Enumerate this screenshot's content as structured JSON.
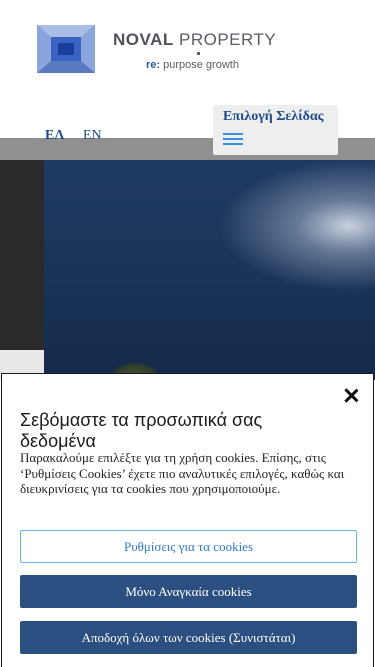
{
  "header": {
    "brand_name": "NOVAL",
    "brand_suffix": "PROPERTY",
    "tagline_prefix": "re:",
    "tagline_text": "purpose growth",
    "page_select_label": "Επιλογή Σελίδας",
    "lang_el": "ΕΛ",
    "lang_en": "EN"
  },
  "cookie": {
    "title": "Σεβόμαστε τα προσωπικά σας δεδομένα",
    "text": "Παρακαλούμε επιλέξτε για τη χρήση cookies. Επίσης, στις ‘Ρυθμίσεις Cookies’ έχετε πιο αναλυτικές επιλογές, καθώς και διευκρινίσεις για τα cookies που χρησιμοποιούμε.",
    "settings_label": "Ρυθμίσεις για τα cookies",
    "necessary_label": "Μόνο Αναγκαία cookies",
    "accept_label": "Αποδοχή όλων των cookies (Συνιστάται)"
  },
  "colors": {
    "primary": "#2b4f80",
    "link": "#1f4a8a",
    "accent": "#67b5ee"
  },
  "icons": [
    "noval-logo-icon",
    "menu-icon",
    "close-icon"
  ]
}
